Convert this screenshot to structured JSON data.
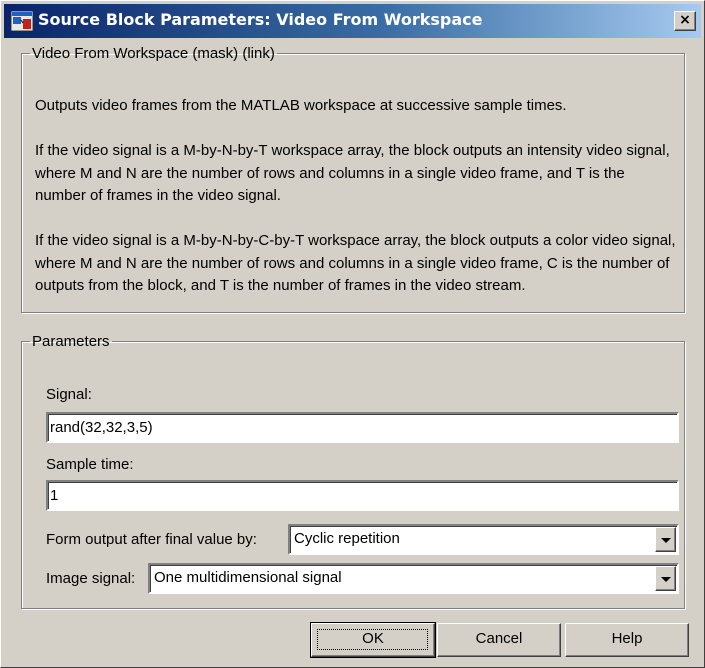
{
  "window": {
    "title": "Source Block Parameters: Video From Workspace",
    "close_label": "×",
    "icon": "simulink-block-icon"
  },
  "description": {
    "group_label": "Video From Workspace (mask) (link)",
    "paragraphs": [
      "Outputs video frames from the MATLAB workspace at successive sample times.",
      "If the video signal is a M-by-N-by-T workspace array, the block outputs an intensity video signal, where M and N are the number of rows and columns in a single video frame, and T is the number of frames in the video signal.",
      "If the video signal is a M-by-N-by-C-by-T workspace array, the block outputs a color video signal, where M and N are the number of rows and columns in a single video frame, C is the number of outputs from the block, and T is the number of frames in the video stream."
    ]
  },
  "parameters": {
    "group_label": "Parameters",
    "signal": {
      "label": "Signal:",
      "value": "rand(32,32,3,5)"
    },
    "sample_time": {
      "label": "Sample time:",
      "value": "1"
    },
    "form_output": {
      "label": "Form output after final value by:",
      "value": "Cyclic repetition"
    },
    "image_signal": {
      "label": "Image signal:",
      "value": "One multidimensional signal"
    }
  },
  "buttons": {
    "ok": "OK",
    "cancel": "Cancel",
    "help": "Help"
  }
}
